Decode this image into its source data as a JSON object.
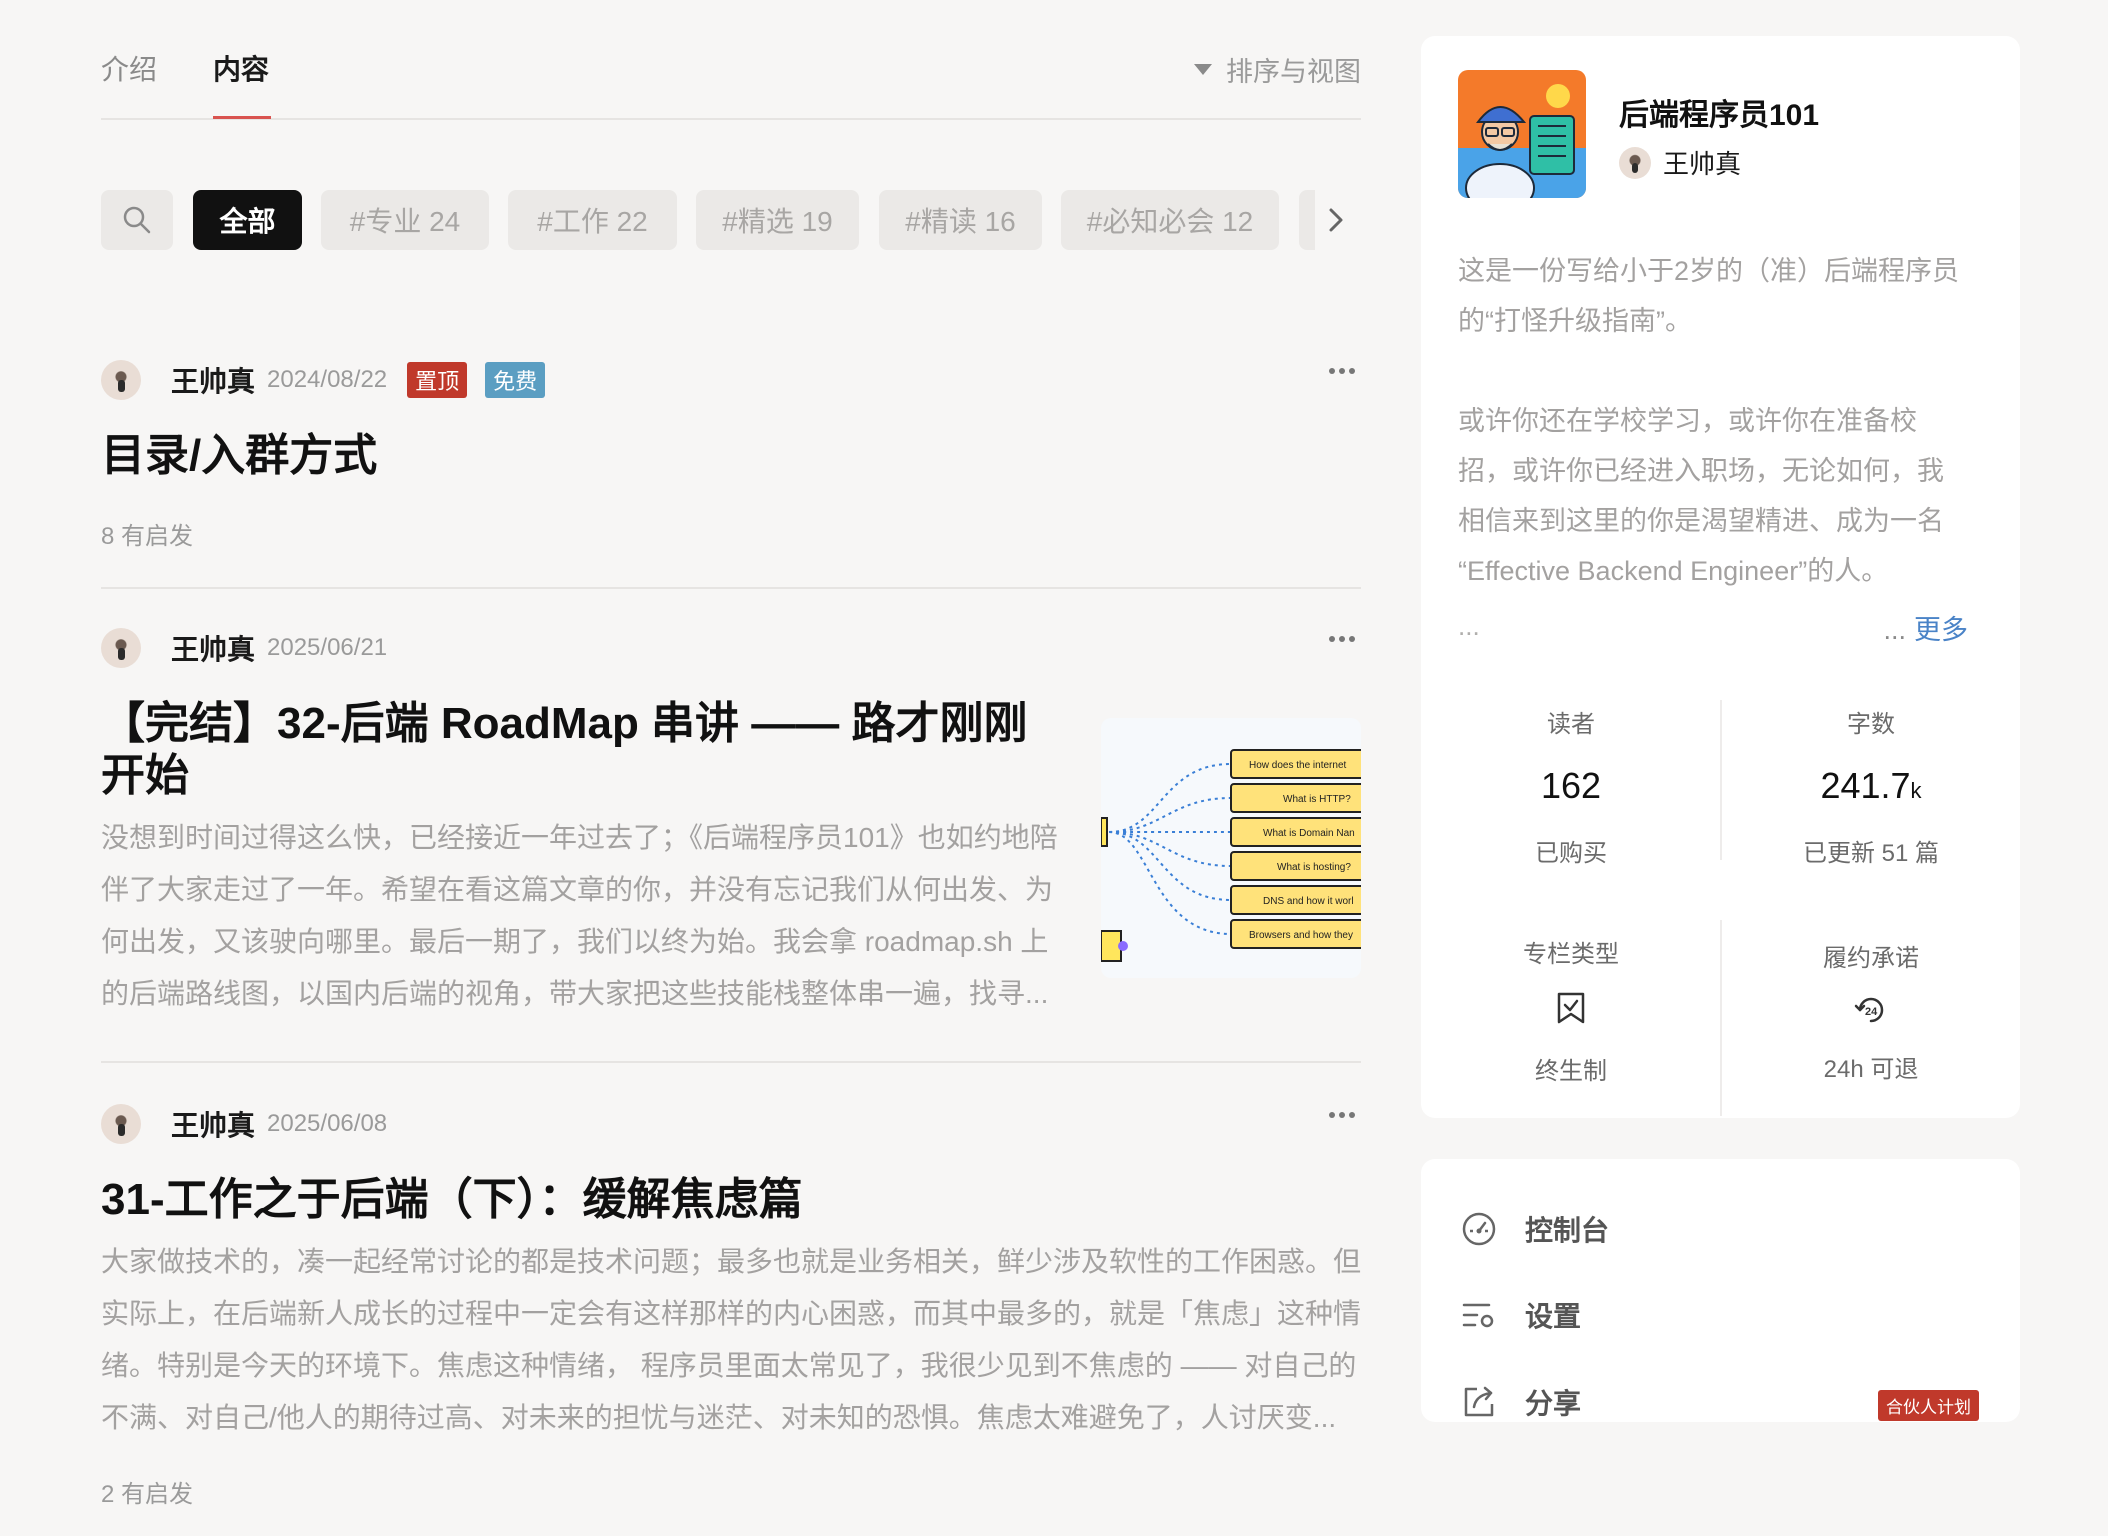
{
  "tabs": [
    {
      "label": "介绍"
    },
    {
      "label": "内容"
    }
  ],
  "sort_label": "排序与视图",
  "filters": [
    {
      "label": "全部"
    },
    {
      "label": "#专业 24"
    },
    {
      "label": "#工作 22"
    },
    {
      "label": "#精选 19"
    },
    {
      "label": "#精读 16"
    },
    {
      "label": "#必知必会 12"
    }
  ],
  "posts": [
    {
      "author": "王帅真",
      "date": "2024/08/22",
      "badges": [
        "置顶",
        "免费"
      ],
      "title": "目录/入群方式",
      "inspired": "8 有启发"
    },
    {
      "author": "王帅真",
      "date": "2025/06/21",
      "title_line1": "【完结】32-后端 RoadMap 串讲 —— 路才刚刚",
      "title_line2": "开始",
      "excerpt": [
        "没想到时间过得这么快，已经接近一年过去了；《后端程序员101》也如约地陪",
        "伴了大家走过了一年。希望在看这篇文章的你，并没有忘记我们从何出发、为",
        "何出发，又该驶向哪里。最后一期了，我们以终为始。我会拿 roadmap.sh 上",
        "的后端路线图，以国内后端的视角，带大家把这些技能栈整体串一遍，找寻..."
      ],
      "thumb_nodes": [
        "How does the internet",
        "What is HTTP?",
        "What is Domain Nan",
        "What is hosting?",
        "DNS and how it worl",
        "Browsers and how they"
      ]
    },
    {
      "author": "王帅真",
      "date": "2025/06/08",
      "title": "31-工作之于后端（下）：缓解焦虑篇",
      "excerpt": [
        "大家做技术的，凑一起经常讨论的都是技术问题；最多也就是业务相关，鲜少涉及软性的工作困惑。但",
        "实际上，在后端新人成长的过程中一定会有这样那样的内心困惑，而其中最多的，就是「焦虑」这种情",
        "绪。特别是今天的环境下。焦虑这种情绪， 程序员里面太常见了，我很少见到不焦虑的 —— 对自己的",
        "不满、对自己/他人的期待过高、对未来的担忧与迷茫、对未知的恐惧。焦虑太难避免了，人讨厌变..."
      ],
      "inspired": "2 有启发"
    }
  ],
  "column": {
    "title": "后端程序员101",
    "author": "王帅真",
    "description": [
      "这是一份写给小于2岁的（准）后端程序员",
      "的“打怪升级指南”。",
      "",
      "或许你还在学校学习，或许你在准备校",
      "招，或许你已经进入职场，无论如何，我",
      "相信来到这里的你是渴望精进、成为一名",
      "“Effective Backend Engineer”的人。"
    ],
    "ellipsis": "...",
    "more_prefix": "...",
    "more_label": "更多",
    "stats": {
      "readers_label": "读者",
      "readers_value": "162",
      "readers_sub": "已购买",
      "words_label": "字数",
      "words_value": "241.7",
      "words_unit": "k",
      "words_sub": "已更新 51 篇",
      "type_label": "专栏类型",
      "type_sub": "终生制",
      "promise_label": "履约承诺",
      "promise_sub": "24h 可退"
    }
  },
  "menu": [
    {
      "label": "控制台"
    },
    {
      "label": "设置"
    },
    {
      "label": "分享",
      "badge": "合伙人计划"
    }
  ],
  "colors": {
    "accent_red": "#c0392b",
    "link_blue": "#4a83c7",
    "free_badge": "#5b9ec2"
  }
}
